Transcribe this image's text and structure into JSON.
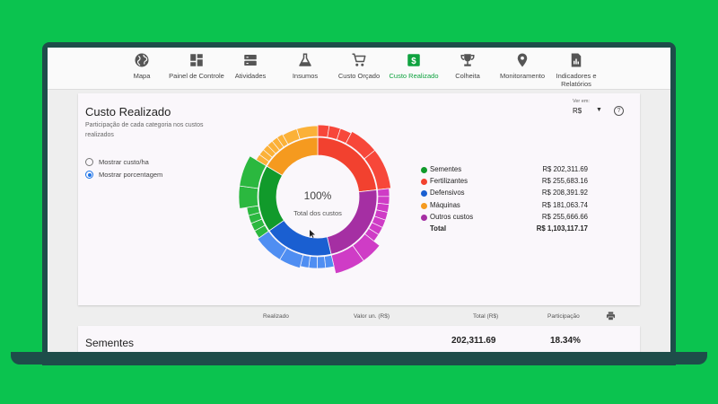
{
  "nav": {
    "items": [
      {
        "label": "Mapa",
        "icon": "globe-icon"
      },
      {
        "label": "Painel de Controle",
        "icon": "dashboard-icon"
      },
      {
        "label": "Atividades",
        "icon": "list-icon"
      },
      {
        "label": "Insumos",
        "icon": "flask-icon"
      },
      {
        "label": "Custo Orçado",
        "icon": "cart-icon"
      },
      {
        "label": "Custo Realizado",
        "icon": "dollar-icon"
      },
      {
        "label": "Colheita",
        "icon": "trophy-icon"
      },
      {
        "label": "Monitoramento",
        "icon": "location-pin-icon"
      },
      {
        "label": "Indicadores e Relatórios",
        "icon": "report-icon"
      }
    ],
    "active_index": 5,
    "active_color": "#0fa23f"
  },
  "card": {
    "title": "Custo Realizado",
    "subtitle": "Participação de cada categoria nos custos realizados",
    "options": [
      {
        "label": "Mostrar custo/ha",
        "checked": false
      },
      {
        "label": "Mostrar porcentagem",
        "checked": true
      }
    ],
    "currency_label": "Ver em:",
    "currency_value": "R$",
    "help": "?"
  },
  "chart_data": {
    "type": "pie",
    "center_value": "100%",
    "center_label": "Total dos custos",
    "categories": [
      "Sementes",
      "Fertilizantes",
      "Defensivos",
      "Máquinas",
      "Outros custos"
    ],
    "values": [
      202311.69,
      255683.16,
      208391.92,
      181063.74,
      255666.66
    ],
    "value_labels": [
      "R$ 202,311.69",
      "R$ 255,683.16",
      "R$ 208,391.92",
      "R$ 181,063.74",
      "R$ 255,666.66"
    ],
    "colors": [
      "#119a2b",
      "#f2412f",
      "#1a5fd1",
      "#f59a1f",
      "#a52fa3"
    ],
    "outer_colors": [
      "#2bb83f",
      "#f7473a",
      "#4f8ef2",
      "#fbb138",
      "#cf3cc6"
    ],
    "total_label": "Total",
    "total_value": "R$ 1,103,117.17"
  },
  "table": {
    "headers": [
      "Realizado",
      "Valor un. (R$)",
      "Total (R$)",
      "Participação"
    ],
    "rows": [
      {
        "name": "Sementes",
        "total": "202,311.69",
        "participation": "18.34%"
      }
    ]
  }
}
